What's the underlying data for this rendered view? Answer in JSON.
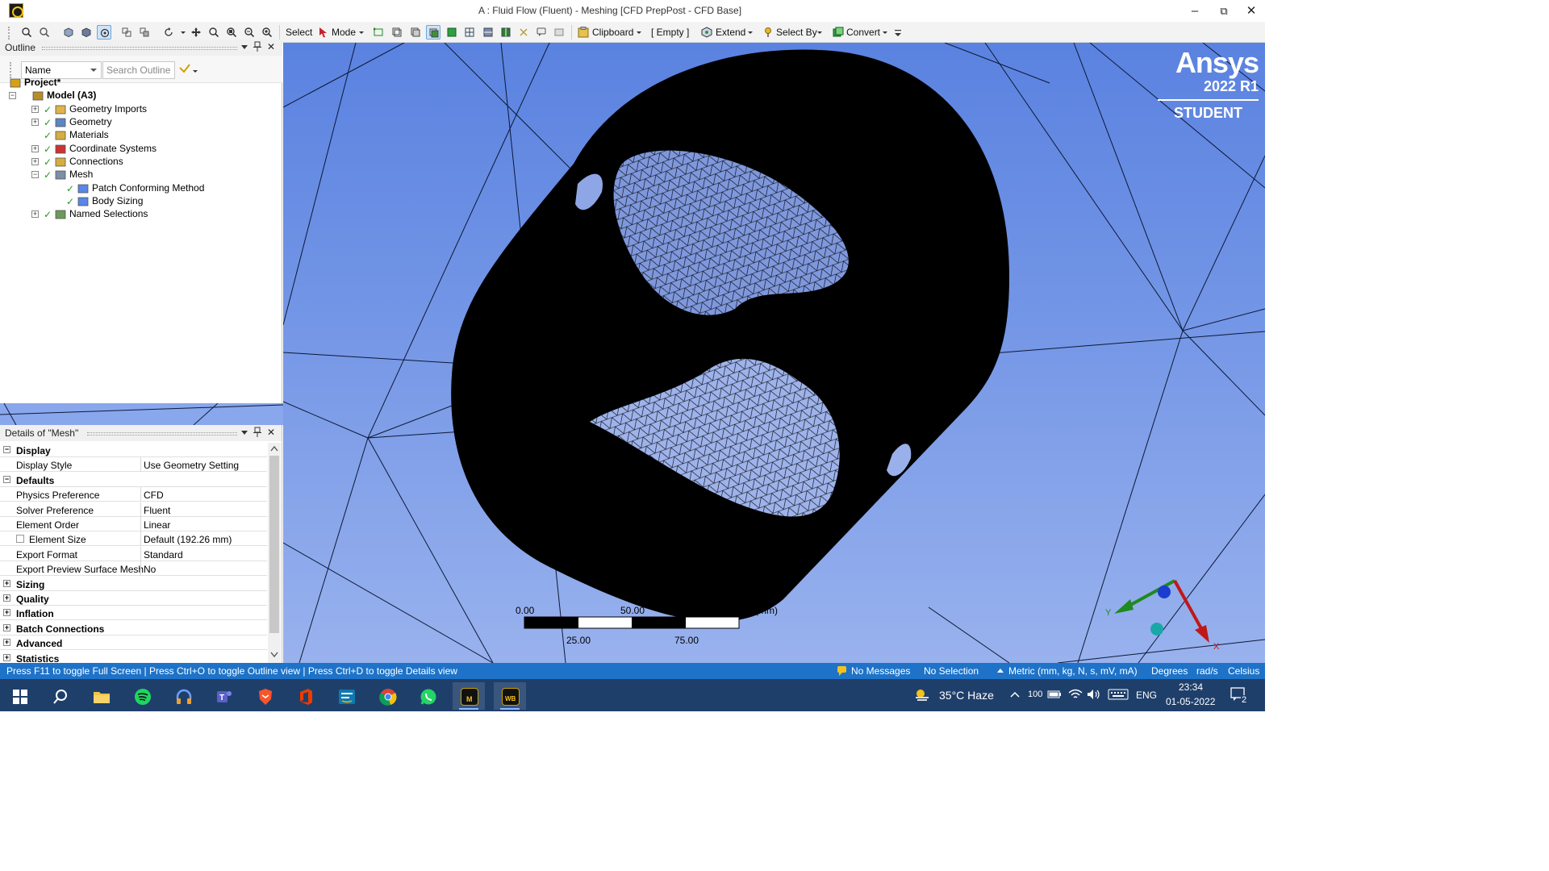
{
  "window": {
    "title": "A : Fluid Flow (Fluent) - Meshing [CFD PrepPost - CFD Base]",
    "minimize": "–",
    "restore": "⧉",
    "close": "✕"
  },
  "toolbar": {
    "select_label": "Select",
    "mode_label": "Mode",
    "clipboard_label": "Clipboard",
    "empty_label": "[ Empty ]",
    "extend_label": "Extend",
    "select_by_label": "Select By",
    "convert_label": "Convert"
  },
  "outline": {
    "title": "Outline",
    "pin": "📌",
    "close": "✕",
    "name_select": "Name",
    "search_placeholder": "Search Outline",
    "tree": [
      {
        "label": "Project*",
        "icon": "project-icon",
        "bold": true
      },
      {
        "label": "Model (A3)",
        "icon": "model-icon",
        "bold": true
      },
      {
        "label": "Geometry Imports",
        "icon": "geometry-imports-icon"
      },
      {
        "label": "Geometry",
        "icon": "geometry-icon"
      },
      {
        "label": "Materials",
        "icon": "materials-icon"
      },
      {
        "label": "Coordinate Systems",
        "icon": "coordinate-systems-icon"
      },
      {
        "label": "Connections",
        "icon": "connections-icon"
      },
      {
        "label": "Mesh",
        "icon": "mesh-icon"
      },
      {
        "label": "Patch Conforming Method",
        "icon": "patch-conforming-icon"
      },
      {
        "label": "Body Sizing",
        "icon": "body-sizing-icon"
      },
      {
        "label": "Named Selections",
        "icon": "named-selections-icon"
      }
    ]
  },
  "details": {
    "title": "Details of \"Mesh\"",
    "rows": [
      {
        "type": "cat",
        "key": "Display"
      },
      {
        "type": "prop",
        "key": "Display Style",
        "value": "Use Geometry Setting"
      },
      {
        "type": "cat",
        "key": "Defaults"
      },
      {
        "type": "prop",
        "key": "Physics Preference",
        "value": "CFD"
      },
      {
        "type": "prop",
        "key": "Solver Preference",
        "value": "Fluent"
      },
      {
        "type": "prop",
        "key": "Element Order",
        "value": "Linear"
      },
      {
        "type": "prop",
        "key": "Element Size",
        "value": "Default (192.26 mm)",
        "checkbox": true
      },
      {
        "type": "prop",
        "key": "Export Format",
        "value": "Standard"
      },
      {
        "type": "prop",
        "key": "Export Preview Surface Mesh",
        "value": "No"
      },
      {
        "type": "cat",
        "key": "Sizing"
      },
      {
        "type": "cat",
        "key": "Quality"
      },
      {
        "type": "cat",
        "key": "Inflation"
      },
      {
        "type": "cat",
        "key": "Batch Connections"
      },
      {
        "type": "cat",
        "key": "Advanced"
      },
      {
        "type": "cat",
        "key": "Statistics"
      }
    ]
  },
  "viewport": {
    "brand": "Ansys",
    "version": "2022 R1",
    "edition": "STUDENT",
    "scale": {
      "t0": "0.00",
      "t50": "50.00",
      "t100": "100.00 (mm)",
      "t25": "25.00",
      "t75": "75.00"
    },
    "triad": {
      "y": "Y",
      "x": "X"
    }
  },
  "status": {
    "hint": "Press F11 to toggle Full Screen | Press Ctrl+O to toggle Outline view | Press Ctrl+D to toggle Details view",
    "messages": "No Messages",
    "selection": "No Selection",
    "units": "Metric (mm, kg, N, s, mV, mA)",
    "angle": "Degrees",
    "rate": "rad/s",
    "temp": "Celsius"
  },
  "taskbar": {
    "weather": "35°C  Haze",
    "battery": "100",
    "lang": "ENG",
    "time": "23:34",
    "date": "01-05-2022",
    "notifications": "2",
    "meshing_label": "M",
    "workbench_label": "WB"
  },
  "colors": {
    "status_bar": "#1e73c8",
    "viewport_top": "#5a82e0",
    "viewport_bottom": "#99b2ee",
    "taskbar": "#1f3f6b"
  }
}
